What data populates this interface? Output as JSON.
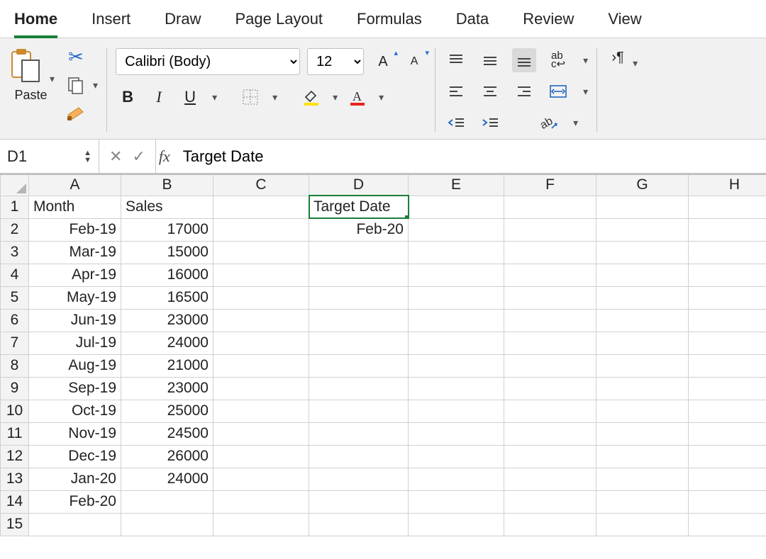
{
  "tabs": {
    "items": [
      "Home",
      "Insert",
      "Draw",
      "Page Layout",
      "Formulas",
      "Data",
      "Review",
      "View"
    ],
    "active_index": 0
  },
  "ribbon": {
    "paste_label": "Paste",
    "font_name": "Calibri (Body)",
    "font_size": "12"
  },
  "formula_bar": {
    "name_box": "D1",
    "fx_label": "fx",
    "value": "Target Date"
  },
  "grid": {
    "columns": [
      "A",
      "B",
      "C",
      "D",
      "E",
      "F",
      "G",
      "H"
    ],
    "row_count": 15,
    "selected_cell": "D1",
    "cells": {
      "A1": {
        "v": "Month",
        "align": "l"
      },
      "B1": {
        "v": "Sales",
        "align": "l"
      },
      "D1": {
        "v": "Target Date",
        "align": "l"
      },
      "A2": {
        "v": "Feb-19",
        "align": "r"
      },
      "B2": {
        "v": "17000",
        "align": "r"
      },
      "D2": {
        "v": "Feb-20",
        "align": "r"
      },
      "A3": {
        "v": "Mar-19",
        "align": "r"
      },
      "B3": {
        "v": "15000",
        "align": "r"
      },
      "A4": {
        "v": "Apr-19",
        "align": "r"
      },
      "B4": {
        "v": "16000",
        "align": "r"
      },
      "A5": {
        "v": "May-19",
        "align": "r"
      },
      "B5": {
        "v": "16500",
        "align": "r"
      },
      "A6": {
        "v": "Jun-19",
        "align": "r"
      },
      "B6": {
        "v": "23000",
        "align": "r"
      },
      "A7": {
        "v": "Jul-19",
        "align": "r"
      },
      "B7": {
        "v": "24000",
        "align": "r"
      },
      "A8": {
        "v": "Aug-19",
        "align": "r"
      },
      "B8": {
        "v": "21000",
        "align": "r"
      },
      "A9": {
        "v": "Sep-19",
        "align": "r"
      },
      "B9": {
        "v": "23000",
        "align": "r"
      },
      "A10": {
        "v": "Oct-19",
        "align": "r"
      },
      "B10": {
        "v": "25000",
        "align": "r"
      },
      "A11": {
        "v": "Nov-19",
        "align": "r"
      },
      "B11": {
        "v": "24500",
        "align": "r"
      },
      "A12": {
        "v": "Dec-19",
        "align": "r"
      },
      "B12": {
        "v": "26000",
        "align": "r"
      },
      "A13": {
        "v": "Jan-20",
        "align": "r"
      },
      "B13": {
        "v": "24000",
        "align": "r"
      },
      "A14": {
        "v": "Feb-20",
        "align": "r"
      }
    }
  }
}
